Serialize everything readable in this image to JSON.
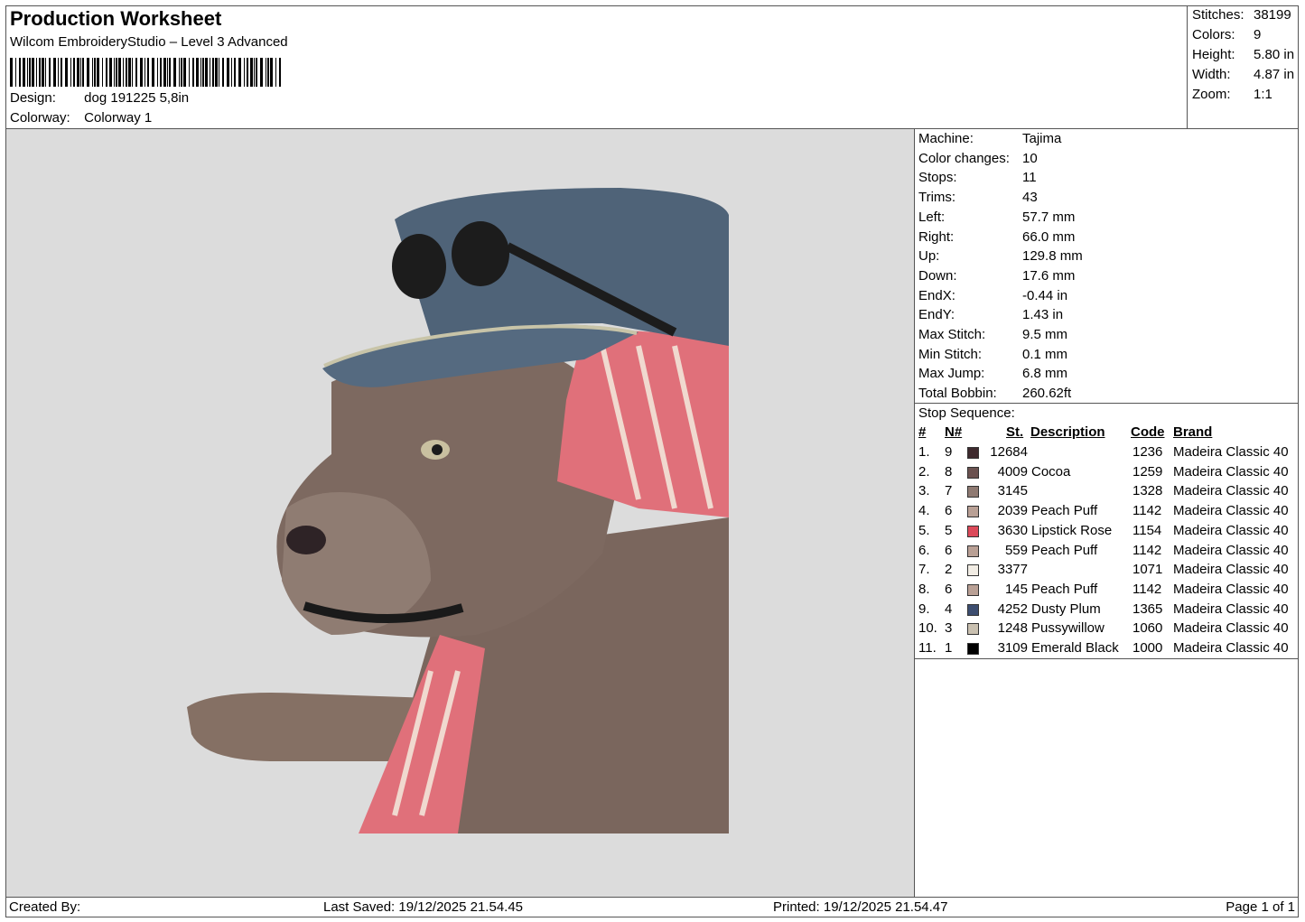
{
  "header": {
    "title": "Production Worksheet",
    "subtitle": "Wilcom EmbroideryStudio – Level 3 Advanced",
    "design_label": "Design:",
    "design_value": "dog 191225 5,8in",
    "colorway_label": "Colorway:",
    "colorway_value": "Colorway 1"
  },
  "stats": [
    {
      "label": "Stitches:",
      "value": "38199"
    },
    {
      "label": "Colors:",
      "value": "9"
    },
    {
      "label": "Height:",
      "value": "5.80 in"
    },
    {
      "label": "Width:",
      "value": "4.87 in"
    },
    {
      "label": "Zoom:",
      "value": "1:1"
    }
  ],
  "machine_info": [
    {
      "label": "Machine:",
      "value": "Tajima"
    },
    {
      "label": "Color changes:",
      "value": "10"
    },
    {
      "label": "Stops:",
      "value": "11"
    },
    {
      "label": "Trims:",
      "value": "43"
    },
    {
      "label": "Left:",
      "value": "57.7 mm"
    },
    {
      "label": "Right:",
      "value": "66.0 mm"
    },
    {
      "label": "Up:",
      "value": "129.8 mm"
    },
    {
      "label": "Down:",
      "value": "17.6 mm"
    },
    {
      "label": "EndX:",
      "value": "-0.44 in"
    },
    {
      "label": "EndY:",
      "value": "1.43 in"
    },
    {
      "label": "Max Stitch:",
      "value": "9.5 mm"
    },
    {
      "label": "Min Stitch:",
      "value": "0.1 mm"
    },
    {
      "label": "Max Jump:",
      "value": "6.8 mm"
    },
    {
      "label": "Total Bobbin:",
      "value": "260.62ft"
    }
  ],
  "stop_sequence": {
    "caption": "Stop Sequence:",
    "headers": {
      "num": "#",
      "needle": "N#",
      "stitches": "St.",
      "description": "Description",
      "code": "Code",
      "brand": "Brand"
    },
    "rows": [
      {
        "num": "1.",
        "needle": "9",
        "color": "#3e2a2e",
        "stitches": "12684",
        "description": "",
        "code": "1236",
        "brand": "Madeira Classic 40"
      },
      {
        "num": "2.",
        "needle": "8",
        "color": "#6b5250",
        "stitches": "4009",
        "description": "Cocoa",
        "code": "1259",
        "brand": "Madeira Classic 40"
      },
      {
        "num": "3.",
        "needle": "7",
        "color": "#8f7a72",
        "stitches": "3145",
        "description": "",
        "code": "1328",
        "brand": "Madeira Classic 40"
      },
      {
        "num": "4.",
        "needle": "6",
        "color": "#b9a095",
        "stitches": "2039",
        "description": "Peach Puff",
        "code": "1142",
        "brand": "Madeira Classic 40"
      },
      {
        "num": "5.",
        "needle": "5",
        "color": "#dc4a5a",
        "stitches": "3630",
        "description": "Lipstick Rose",
        "code": "1154",
        "brand": "Madeira Classic 40"
      },
      {
        "num": "6.",
        "needle": "6",
        "color": "#b9a095",
        "stitches": "559",
        "description": "Peach Puff",
        "code": "1142",
        "brand": "Madeira Classic 40"
      },
      {
        "num": "7.",
        "needle": "2",
        "color": "#f1ece4",
        "stitches": "3377",
        "description": "",
        "code": "1071",
        "brand": "Madeira Classic 40"
      },
      {
        "num": "8.",
        "needle": "6",
        "color": "#b9a095",
        "stitches": "145",
        "description": "Peach Puff",
        "code": "1142",
        "brand": "Madeira Classic 40"
      },
      {
        "num": "9.",
        "needle": "4",
        "color": "#3d4e70",
        "stitches": "4252",
        "description": "Dusty Plum",
        "code": "1365",
        "brand": "Madeira Classic 40"
      },
      {
        "num": "10.",
        "needle": "3",
        "color": "#c9c0b0",
        "stitches": "1248",
        "description": "Pussywillow",
        "code": "1060",
        "brand": "Madeira Classic 40"
      },
      {
        "num": "11.",
        "needle": "1",
        "color": "#000000",
        "stitches": "3109",
        "description": "Emerald Black",
        "code": "1000",
        "brand": "Madeira Classic 40"
      }
    ]
  },
  "footer": {
    "created_by": "Created By:",
    "last_saved": "Last Saved: 19/12/2025 21.54.45",
    "printed": "Printed: 19/12/2025 21.54.47",
    "page": "Page 1 of 1"
  },
  "colors": {
    "canvas_bg": "#dcdcdc",
    "cap": "#4f6378",
    "fur": "#7d6960",
    "scarf": "#e0707a",
    "glasses": "#1c1c1c"
  }
}
